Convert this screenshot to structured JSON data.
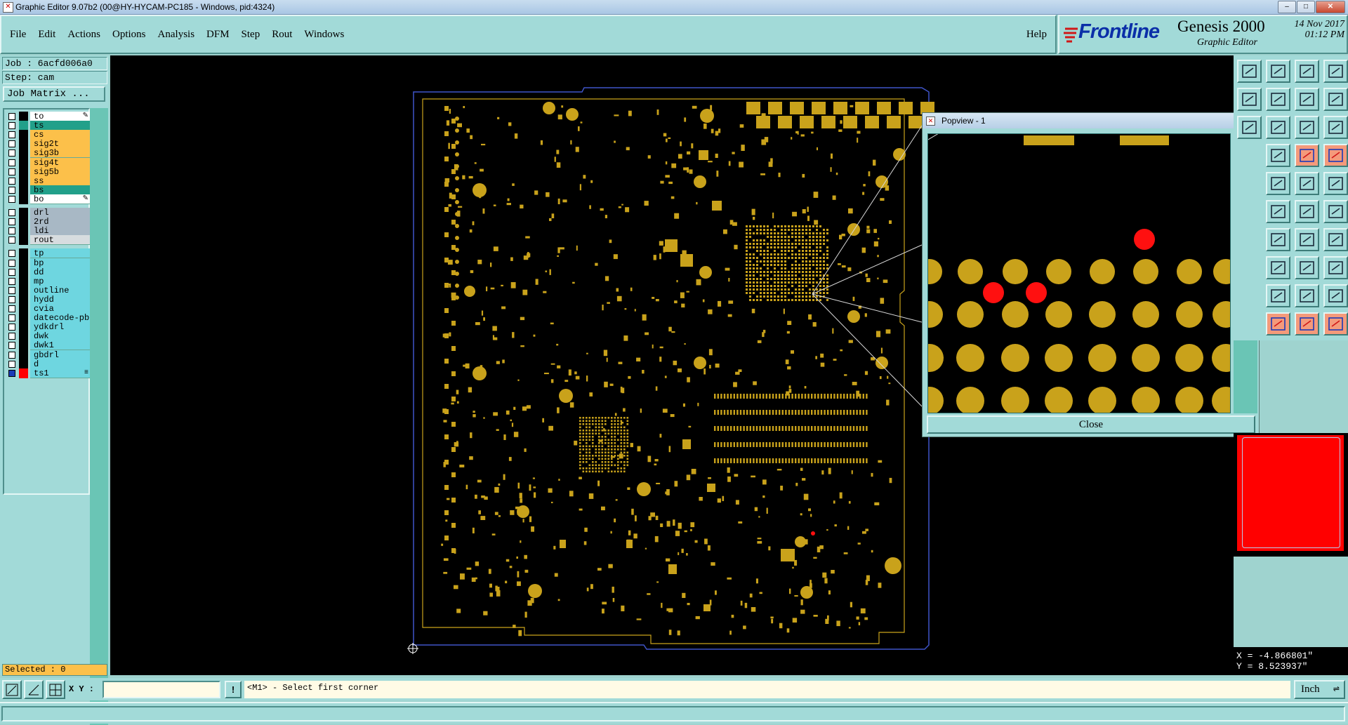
{
  "window": {
    "title": "Graphic Editor 9.07b2 (00@HY-HYCAM-PC185 - Windows, pid:4324)",
    "controls": [
      "minimize",
      "maximize",
      "close"
    ]
  },
  "menu": {
    "items": [
      "File",
      "Edit",
      "Actions",
      "Options",
      "Analysis",
      "DFM",
      "Step",
      "Rout",
      "Windows"
    ],
    "help": "Help"
  },
  "brand": {
    "logo": "Frontline",
    "product": "Genesis 2000",
    "subtitle": "Graphic Editor",
    "date": "14 Nov 2017",
    "time": "01:12 PM"
  },
  "job": {
    "job_line": "Job : 6acfd006a0",
    "step_line": "Step: cam",
    "matrix_button": "Job Matrix ..."
  },
  "layers": [
    {
      "name": "to",
      "color": "#ffffff",
      "swatch": "#000000",
      "checked": false,
      "flag": "pen"
    },
    {
      "name": "ts",
      "color": "#22a08a",
      "swatch": "#22a08a",
      "checked": false,
      "flag": ""
    },
    {
      "name": "cs",
      "color": "#fcc04a",
      "swatch": "#000000",
      "checked": false,
      "flag": ""
    },
    {
      "name": "sig2t",
      "color": "#fcc04a",
      "swatch": "#000000",
      "checked": false,
      "flag": ""
    },
    {
      "name": "sig3b",
      "color": "#fcc04a",
      "swatch": "#000000",
      "checked": false,
      "flag": ""
    },
    {
      "name": "sig4t",
      "color": "#fcc04a",
      "swatch": "#000000",
      "checked": false,
      "flag": ""
    },
    {
      "name": "sig5b",
      "color": "#fcc04a",
      "swatch": "#000000",
      "checked": false,
      "flag": ""
    },
    {
      "name": "ss",
      "color": "#fcc04a",
      "swatch": "#000000",
      "checked": false,
      "flag": ""
    },
    {
      "name": "bs",
      "color": "#22a08a",
      "swatch": "#000000",
      "checked": false,
      "flag": ""
    },
    {
      "name": "bo",
      "color": "#ffffff",
      "swatch": "#000000",
      "checked": false,
      "flag": "pen"
    },
    {
      "name": "drl",
      "color": "#a8b8c5",
      "swatch": "#000000",
      "checked": false,
      "flag": ""
    },
    {
      "name": "2rd",
      "color": "#a8b8c5",
      "swatch": "#000000",
      "checked": false,
      "flag": ""
    },
    {
      "name": "ldi",
      "color": "#a8b8c5",
      "swatch": "#000000",
      "checked": false,
      "flag": ""
    },
    {
      "name": "rout",
      "color": "#d7dcdf",
      "swatch": "#000000",
      "checked": false,
      "flag": ""
    },
    {
      "name": "tp",
      "color": "#6ed6e0",
      "swatch": "#000000",
      "checked": false,
      "flag": ""
    },
    {
      "name": "bp",
      "color": "#6ed6e0",
      "swatch": "#000000",
      "checked": false,
      "flag": ""
    },
    {
      "name": "dd",
      "color": "#6ed6e0",
      "swatch": "#000000",
      "checked": false,
      "flag": ""
    },
    {
      "name": "mp",
      "color": "#6ed6e0",
      "swatch": "#000000",
      "checked": false,
      "flag": ""
    },
    {
      "name": "outline",
      "color": "#6ed6e0",
      "swatch": "#000000",
      "checked": false,
      "flag": ""
    },
    {
      "name": "hydd",
      "color": "#6ed6e0",
      "swatch": "#000000",
      "checked": false,
      "flag": ""
    },
    {
      "name": "cvia",
      "color": "#6ed6e0",
      "swatch": "#000000",
      "checked": false,
      "flag": ""
    },
    {
      "name": "datecode-pbc",
      "color": "#6ed6e0",
      "swatch": "#000000",
      "checked": false,
      "flag": ""
    },
    {
      "name": "ydkdrl",
      "color": "#6ed6e0",
      "swatch": "#000000",
      "checked": false,
      "flag": ""
    },
    {
      "name": "dwk",
      "color": "#6ed6e0",
      "swatch": "#000000",
      "checked": false,
      "flag": ""
    },
    {
      "name": "dwk1",
      "color": "#6ed6e0",
      "swatch": "#000000",
      "checked": false,
      "flag": ""
    },
    {
      "name": "gbdrl",
      "color": "#6ed6e0",
      "swatch": "#000000",
      "checked": false,
      "flag": ""
    },
    {
      "name": "d",
      "color": "#6ed6e0",
      "swatch": "#000000",
      "checked": false,
      "flag": ""
    },
    {
      "name": "ts1",
      "color": "#6ed6e0",
      "swatch": "#ff0000",
      "checked": true,
      "flag": "grip"
    }
  ],
  "selected": "Selected : 0",
  "popview": {
    "title": "Popview - 1",
    "close_label": "Close"
  },
  "coordinates": {
    "x": "X = -4.866801\"",
    "y": "Y = 8.523937\""
  },
  "statusbar": {
    "xy_label": "X Y :",
    "xy_value": "",
    "exclamation": "!",
    "prompt": "<M1> - Select first corner",
    "units": "Inch"
  },
  "colors": {
    "pad": "#c9a21b",
    "highlight": "#ff1010",
    "profile": "#3f54c8",
    "panel": "#a2dad8"
  }
}
